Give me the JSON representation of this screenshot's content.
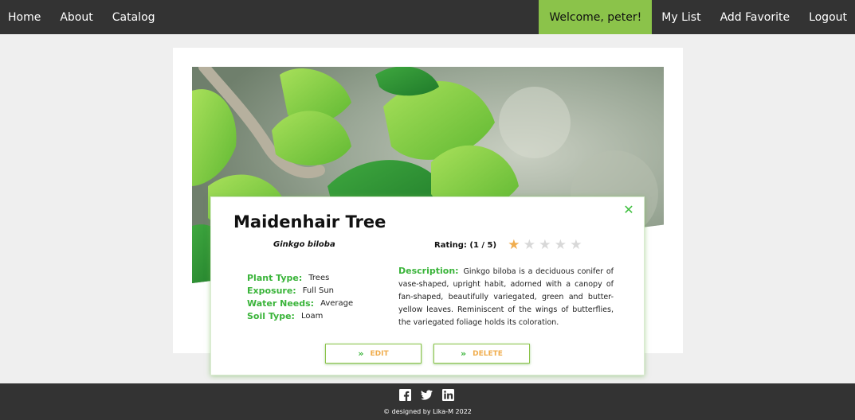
{
  "nav": {
    "left": [
      "Home",
      "About",
      "Catalog"
    ],
    "welcome": "Welcome, peter!",
    "right": [
      "My List",
      "Add Favorite",
      "Logout"
    ]
  },
  "plant": {
    "name": "Maidenhair Tree",
    "latin": "Ginkgo biloba",
    "rating_label": "Rating: (1 / 5)",
    "rating": 1,
    "rating_max": 5,
    "props": [
      {
        "label": "Plant Type:",
        "value": "Trees"
      },
      {
        "label": "Exposure:",
        "value": "Full Sun"
      },
      {
        "label": "Water Needs:",
        "value": "Average"
      },
      {
        "label": "Soil Type:",
        "value": "Loam"
      }
    ],
    "description_label": "Description:",
    "description": "Ginkgo biloba is a deciduous conifer of vase-shaped, upright habit, adorned with a canopy of fan-shaped, beautifully variegated, green and butter-yellow leaves. Reminiscent of the wings of butterflies, the variegated foliage holds its coloration."
  },
  "buttons": {
    "edit": "EDIT",
    "delete": "DELETE"
  },
  "footer": {
    "social": [
      "facebook-icon",
      "twitter-icon",
      "linkedin-icon"
    ],
    "copyright": "© designed by Lika-M 2022"
  },
  "colors": {
    "nav_bg": "#333333",
    "accent_green": "#8bc34a",
    "label_green": "#3ab43a",
    "button_text": "#f0ad4e",
    "star_on": "#f0ad4e"
  }
}
